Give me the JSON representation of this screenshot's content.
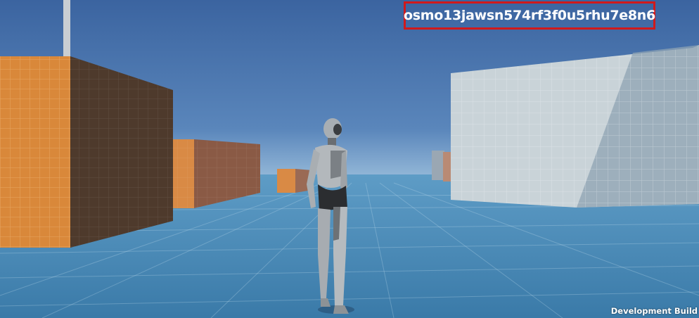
{
  "hud": {
    "session_id": "osmo13jawsn574rf3f0u5rhu7e8n6",
    "build_label": "Development Build"
  },
  "colors": {
    "sky_top": "#3e6aa5",
    "sky_horizon": "#8fb4d6",
    "ground": "#3f7fae",
    "orange_wall": "#d88a3b",
    "white_wall": "#c7d1d6",
    "highlight_border": "#d0191b"
  },
  "scene": {
    "objects": [
      "orange-box-left",
      "orange-box-mid",
      "orange-box-far",
      "white-wall-right",
      "pole",
      "humanoid-character"
    ]
  }
}
